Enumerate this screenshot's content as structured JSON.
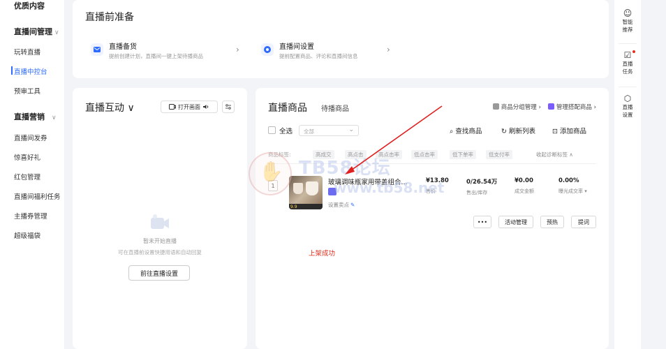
{
  "sidebar": {
    "top_item": "优质内容",
    "group1": {
      "label": "直播间管理",
      "chevron": "∨"
    },
    "group1_items": [
      "玩转直播",
      "直播中控台",
      "预审工具"
    ],
    "group2": {
      "label": "直播营销",
      "chevron": "∨"
    },
    "group2_items": [
      "直播间发券",
      "惊喜好礼",
      "红包管理",
      "直播间福利任务",
      "主播券管理",
      "超级福袋"
    ]
  },
  "prep": {
    "title": "直播前准备",
    "card1": {
      "title": "直播备货",
      "desc": "提前创建计划，直播间一键上架待播商品",
      "arrow": "›"
    },
    "card2": {
      "title": "直播间设置",
      "desc": "提前配置商品、评论和直播间信息",
      "arrow": "›"
    }
  },
  "interact": {
    "title": "直播互动 ∨",
    "open_screen": "打开画面",
    "empty_line1": "暂未开始直播",
    "empty_line2": "可在直播前设置快捷用语和自动回复",
    "goto_button": "前往直播设置"
  },
  "products": {
    "title": "直播商品",
    "tab": "待播商品",
    "link_group": "商品分组管理 ›",
    "link_bundle": "管理搭配商品 ›",
    "select_all": "全选",
    "dropdown": "全部",
    "search": "查找商品",
    "refresh": "刷新列表",
    "add": "添加商品",
    "tags_label": "商品标签:",
    "tags": [
      "高成交",
      "高点击",
      "高点击率",
      "低点击率",
      "低下单率",
      "低支付率"
    ],
    "collapse": "收起诊断标签 ∧",
    "item": {
      "index": "1",
      "name": "玻璃调味瓶家用带盖组合...",
      "thumb_price": "9.9",
      "sell_point": "设置卖点",
      "price": {
        "value": "¥13.80",
        "label": "售价"
      },
      "stock": {
        "value": "0/26.54万",
        "label": "售出/库存"
      },
      "amount": {
        "value": "¥0.00",
        "label": "成交金额"
      },
      "rate": {
        "value": "0.00%",
        "label": "曝光成交率 ▾"
      }
    },
    "buttons": {
      "more": "•••",
      "activity": "活动管理",
      "preheat": "预热",
      "explain": "提词"
    },
    "success": "上架成功"
  },
  "rail": {
    "items": [
      {
        "icon": "☺",
        "label1": "智能",
        "label2": "推荐"
      },
      {
        "icon": "☑",
        "label1": "直播",
        "label2": "任务"
      },
      {
        "icon": "⬡",
        "label1": "直播",
        "label2": "设置"
      }
    ]
  },
  "watermark": {
    "text": "TB58论坛",
    "url": "www.tb58.net"
  },
  "colors": {
    "accent": "#2f6bff",
    "success_red": "#e0301e",
    "arrow_red": "#e0201e"
  }
}
